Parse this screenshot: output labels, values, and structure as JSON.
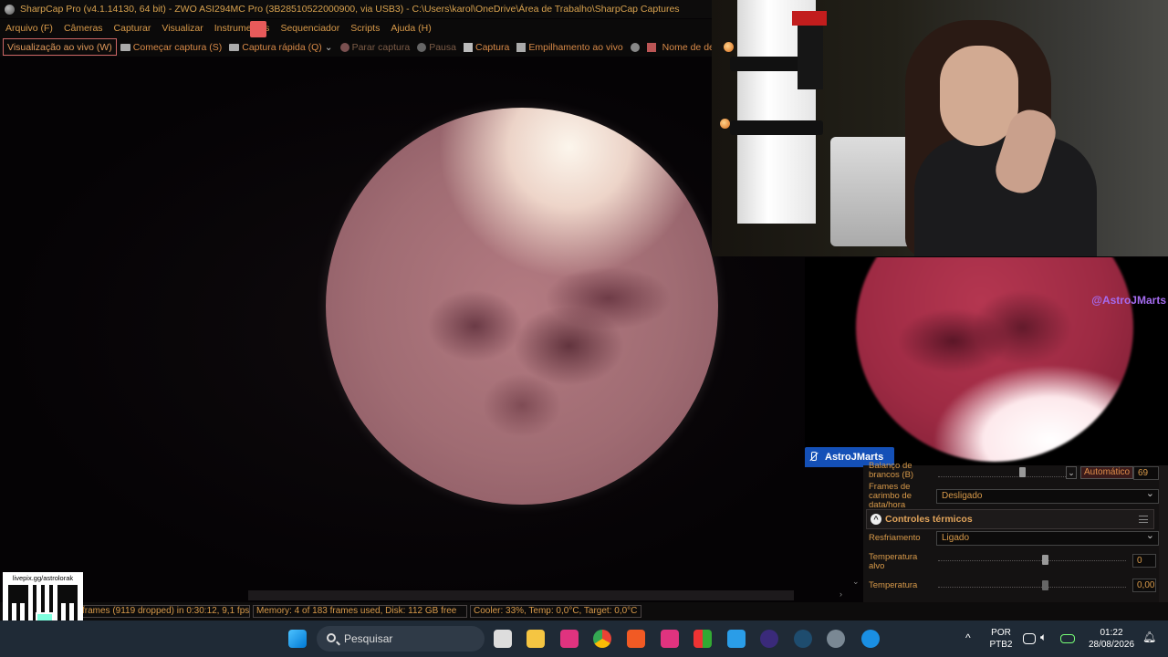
{
  "window": {
    "title": "SharpCap Pro (v4.1.14130, 64 bit) - ZWO ASI294MC Pro (3B28510522000900, via USB3) - C:\\Users\\karol\\OneDrive\\Área de Trabalho\\SharpCap Captures"
  },
  "menu": [
    "Arquivo (F)",
    "Câmeras",
    "Capturar",
    "Visualizar",
    "Instrumentos",
    "Sequenciador",
    "Scripts",
    "Ajuda (H)"
  ],
  "toolbar": {
    "live_view": "Visualização ao vivo (W)",
    "start_capture": "Começar captura (S)",
    "quick_capture": "Captura rápida (Q)",
    "stop_capture": "Parar captura",
    "pause": "Pausa",
    "snapshot": "Captura",
    "live_stack": "Empilhamento ao vivo",
    "target_name": "Nome de destino"
  },
  "overlay": {
    "handle": "@AstroJMarts",
    "name_badge": "AstroJMarts",
    "qr_url": "livepix.gg/astrolorak"
  },
  "controls": {
    "white_balance_label": "Balanço de brancos (B)",
    "auto_label": "Automático",
    "white_balance_value": "69",
    "timestamp_label": "Frames de carimbo de data/hora",
    "timestamp_value": "Desligado",
    "thermal_section": "Controles térmicos",
    "cooling_label": "Resfriamento",
    "cooling_value": "Ligado",
    "target_temp_label": "Temperatura alvo",
    "target_temp_value": "0",
    "temp_label": "Temperatura",
    "temp_value": "0,00"
  },
  "status": {
    "frames": "frames (9119 dropped) in 0:30:12, 9,1 fps",
    "memory": "Memory: 4 of 183 frames used, Disk: 112 GB free",
    "cooler": "Cooler: 33%, Temp: 0,0°C, Target: 0,0°C"
  },
  "taskbar": {
    "search_placeholder": "Pesquisar",
    "lang_line1": "POR",
    "lang_line2": "PTB2",
    "time": "01:22",
    "date": "28/08/2026"
  },
  "colors": {
    "accent_text": "#d89a4a",
    "taskbar": "#1f2a36",
    "badge_blue": "#1450b7",
    "handle_purple": "#a56cf0"
  }
}
